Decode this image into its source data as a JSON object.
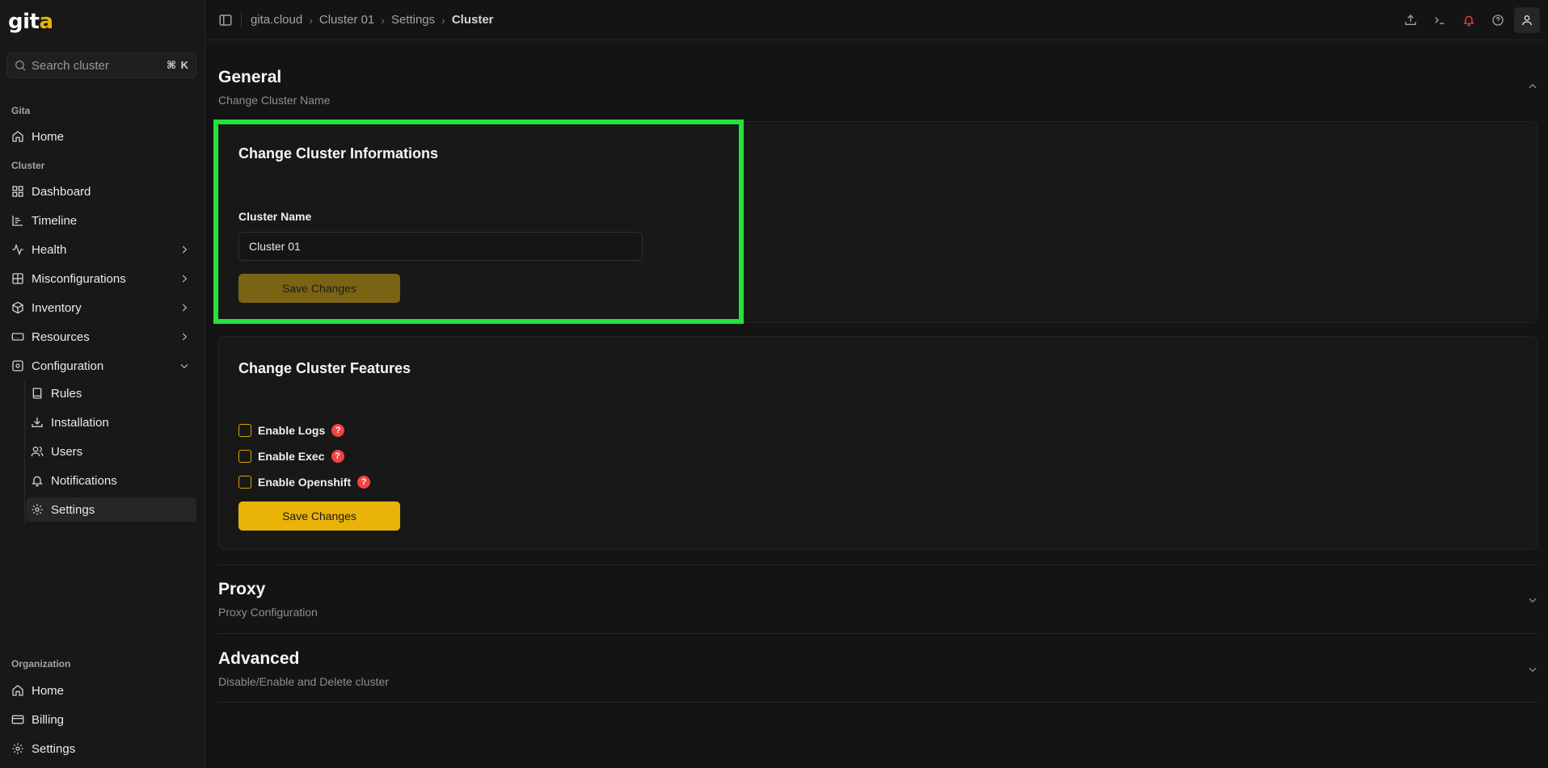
{
  "app": {
    "logo_text": "git",
    "logo_suffix": "a"
  },
  "search": {
    "placeholder": "Search cluster",
    "shortcut": "⌘ K"
  },
  "sidebar": {
    "gita_label": "Gita",
    "gita_items": [
      {
        "label": "Home",
        "icon": "home-icon"
      }
    ],
    "cluster_label": "Cluster",
    "cluster_items": [
      {
        "label": "Dashboard",
        "icon": "grid-icon"
      },
      {
        "label": "Timeline",
        "icon": "timeline-icon"
      },
      {
        "label": "Health",
        "icon": "activity-icon"
      },
      {
        "label": "Misconfigurations",
        "icon": "misconfig-icon"
      },
      {
        "label": "Inventory",
        "icon": "box-icon"
      },
      {
        "label": "Resources",
        "icon": "resources-icon"
      },
      {
        "label": "Configuration",
        "icon": "configuration-icon"
      }
    ],
    "config_subitems": [
      {
        "label": "Rules",
        "icon": "book-icon"
      },
      {
        "label": "Installation",
        "icon": "install-icon"
      },
      {
        "label": "Users",
        "icon": "users-icon"
      },
      {
        "label": "Notifications",
        "icon": "bell-icon"
      },
      {
        "label": "Settings",
        "icon": "gear-icon",
        "active": true
      }
    ],
    "org_label": "Organization",
    "org_items": [
      {
        "label": "Home",
        "icon": "home-icon"
      },
      {
        "label": "Billing",
        "icon": "card-icon"
      },
      {
        "label": "Settings",
        "icon": "gear-icon"
      }
    ]
  },
  "breadcrumb": [
    "gita.cloud",
    "Cluster 01",
    "Settings",
    "Cluster"
  ],
  "header_icons": [
    "upload-icon",
    "terminal-icon",
    "bell-icon",
    "help-icon",
    "user-icon"
  ],
  "general": {
    "title": "General",
    "subtitle": "Change Cluster Name",
    "info_card": {
      "title": "Change Cluster Informations",
      "field_label": "Cluster Name",
      "field_value": "Cluster 01",
      "save_label": "Save Changes"
    },
    "features_card": {
      "title": "Change Cluster Features",
      "options": [
        "Enable Logs",
        "Enable Exec",
        "Enable Openshift"
      ],
      "help_glyph": "?",
      "save_label": "Save Changes"
    }
  },
  "proxy": {
    "title": "Proxy",
    "subtitle": "Proxy Configuration"
  },
  "advanced": {
    "title": "Advanced",
    "subtitle": "Disable/Enable and Delete cluster"
  },
  "colors": {
    "accent": "#eab308",
    "highlight": "#22e33a",
    "danger": "#ef4444"
  }
}
